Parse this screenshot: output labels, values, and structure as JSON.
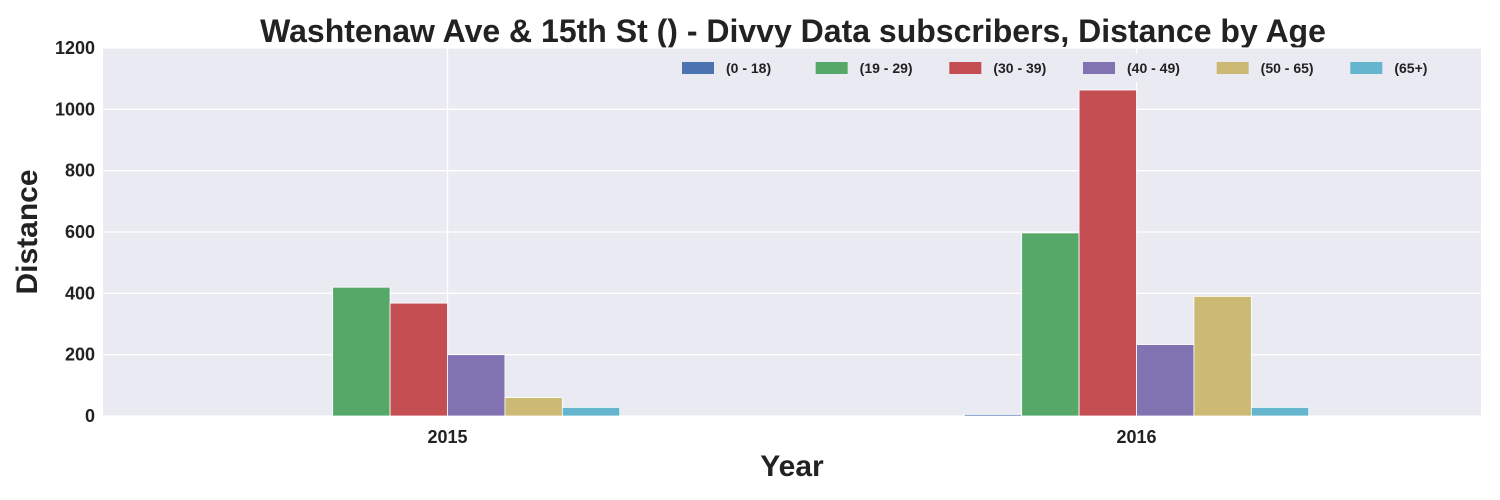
{
  "chart_data": {
    "type": "bar",
    "title": "Washtenaw Ave & 15th St () - Divvy Data subscribers, Distance by Age",
    "xlabel": "Year",
    "ylabel": "Distance",
    "categories": [
      "2015",
      "2016"
    ],
    "ylim": [
      0,
      1200
    ],
    "yticks": [
      0,
      200,
      400,
      600,
      800,
      1000,
      1200
    ],
    "grid": true,
    "legend_position": "top-right",
    "series": [
      {
        "name": "(0 - 18)",
        "color": "#4c72b0",
        "values": [
          0,
          5
        ]
      },
      {
        "name": "(19 - 29)",
        "color": "#55a868",
        "values": [
          420,
          597
        ]
      },
      {
        "name": "(30 - 39)",
        "color": "#c44e52",
        "values": [
          368,
          1063
        ]
      },
      {
        "name": "(40 - 49)",
        "color": "#8172b2",
        "values": [
          200,
          233
        ]
      },
      {
        "name": "(50 - 65)",
        "color": "#ccb974",
        "values": [
          60,
          390
        ]
      },
      {
        "name": "(65+)",
        "color": "#64b5cd",
        "values": [
          28,
          28
        ]
      }
    ]
  },
  "colors": {
    "plot_background": "#eaeaf2",
    "grid": "#ffffff"
  }
}
